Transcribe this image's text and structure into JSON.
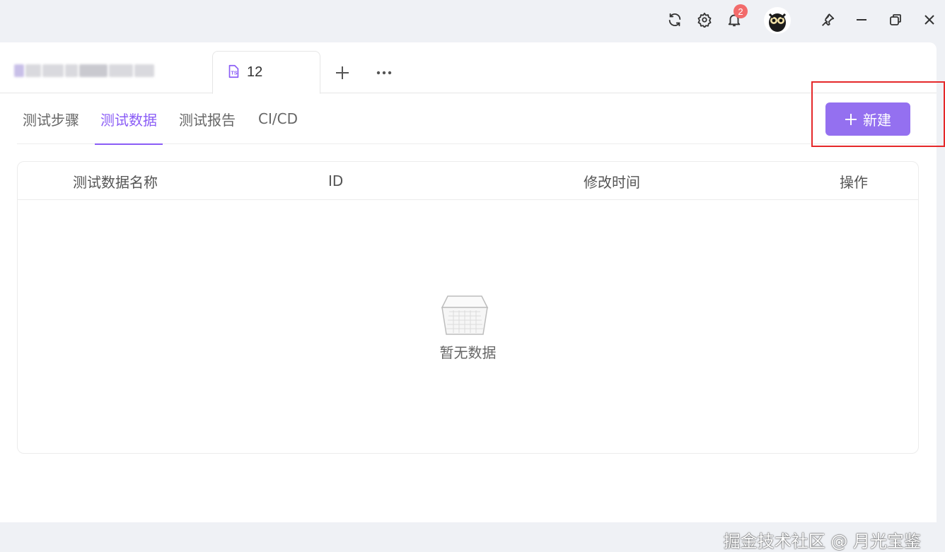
{
  "titlebar": {
    "notifications_count": "2",
    "icons": [
      "refresh-icon",
      "gear-icon",
      "bell-icon",
      "avatar",
      "pin-icon",
      "minimize-icon",
      "restore-icon",
      "close-icon"
    ]
  },
  "tabs": {
    "active_tab_label": "12",
    "active_tab_icon": "ts-file-icon",
    "add_icon": "plus-icon",
    "more_icon": "more-dots-icon"
  },
  "subtabs": [
    {
      "label": "测试步骤",
      "active": false
    },
    {
      "label": "测试数据",
      "active": true
    },
    {
      "label": "测试报告",
      "active": false
    },
    {
      "label": "CI/CD",
      "active": false
    }
  ],
  "new_button": {
    "label": "新建",
    "icon": "plus-icon"
  },
  "table": {
    "columns": [
      "测试数据名称",
      "ID",
      "修改时间",
      "操作"
    ],
    "empty_text": "暂无数据"
  },
  "watermark": "掘金技术社区 @ 月光宝鉴",
  "colors": {
    "accent": "#8a5cf6",
    "button_bg": "#9470f0",
    "highlight_box": "#e5282a",
    "badge": "#f26b6b"
  }
}
